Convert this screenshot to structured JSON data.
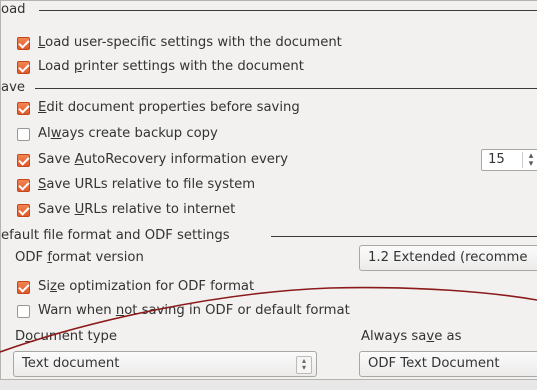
{
  "load": {
    "header": "oad",
    "items": [
      {
        "label_pre": "",
        "mnemonic": "L",
        "label_post": "oad user-specific settings with the document",
        "checked": true
      },
      {
        "label_pre": "Load ",
        "mnemonic": "p",
        "label_post": "rinter settings with the document",
        "checked": true
      }
    ]
  },
  "save": {
    "header": "ave",
    "items": [
      {
        "label_pre": "",
        "mnemonic": "E",
        "label_post": "dit document properties before saving",
        "checked": true
      },
      {
        "label_pre": "Al",
        "mnemonic": "w",
        "label_post": "ays create backup copy",
        "checked": false
      },
      {
        "label_pre": "Save ",
        "mnemonic": "A",
        "label_post": "utoRecovery information every",
        "checked": true
      },
      {
        "label_pre": "",
        "mnemonic": "S",
        "label_post": "ave URLs relative to file system",
        "checked": true
      },
      {
        "label_pre": "Save ",
        "mnemonic": "U",
        "label_post": "RLs relative to internet",
        "checked": true
      }
    ],
    "autorecovery_minutes": "15"
  },
  "format": {
    "header": "efault file format and ODF settings",
    "odf_version_label_pre": "ODF ",
    "odf_version_mnemonic": "f",
    "odf_version_label_post": "ormat version",
    "odf_version_value": "1.2 Extended (recomme",
    "items": [
      {
        "label_pre": "Si",
        "mnemonic": "z",
        "label_post": "e optimization for ODF format",
        "checked": true
      },
      {
        "label_pre": "Warn when ",
        "mnemonic": "n",
        "label_post": "ot saving in ODF or default format",
        "checked": false
      }
    ],
    "document_type_label_pre": "D",
    "document_type_mnemonic": "o",
    "document_type_label_post": "cument type",
    "document_type_value": "Text document",
    "always_save_as_label_pre": "Always sa",
    "always_save_as_mnemonic": "v",
    "always_save_as_label_post": "e as",
    "always_save_as_value": "ODF Text Document"
  },
  "colors": {
    "accent": "#e2592a",
    "curve": "#8b1a1a"
  }
}
